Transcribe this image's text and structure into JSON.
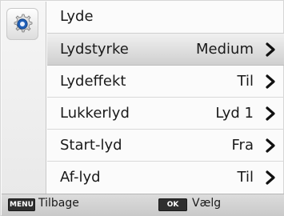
{
  "section_icon": "gear-icon",
  "header": {
    "title": "Lyde"
  },
  "rows": [
    {
      "label": "Lydstyrke",
      "value": "Medium",
      "selected": true
    },
    {
      "label": "Lydeffekt",
      "value": "Til",
      "selected": false
    },
    {
      "label": "Lukkerlyd",
      "value": "Lyd 1",
      "selected": false
    },
    {
      "label": "Start-lyd",
      "value": "Fra",
      "selected": false
    },
    {
      "label": "Af-lyd",
      "value": "Til",
      "selected": false
    }
  ],
  "footer": {
    "menu_key": "MENU",
    "back_label": "Tilbage",
    "ok_key": "OK",
    "select_label": "Vælg"
  },
  "colors": {
    "selected_row": "#d3d3d3",
    "footer_bg": "#d2d2d2",
    "icon_blue": "#1f5fb6"
  }
}
